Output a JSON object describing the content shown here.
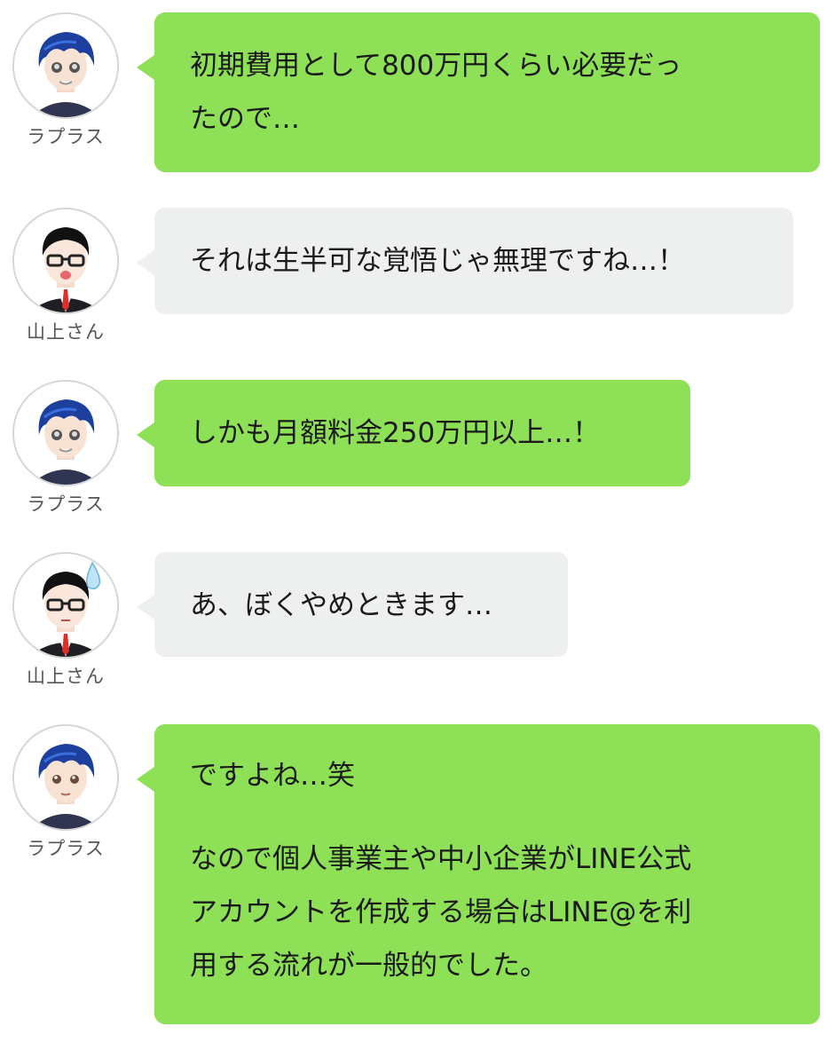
{
  "colors": {
    "laplace_bubble": "#8ee056",
    "yamagami_bubble": "#eef0ef",
    "avatar_border": "#d6d6d6"
  },
  "speakers": {
    "laplace": "ラプラス",
    "yamagami": "山上さん"
  },
  "messages": [
    {
      "speaker": "ラプラス",
      "avatar": "blue-hair-boy-avatar",
      "lines": [
        "初期費用として800万円くらい必要だっ",
        "たので…"
      ]
    },
    {
      "speaker": "山上さん",
      "avatar": "glasses-man-avatar",
      "lines": [
        "それは生半可な覚悟じゃ無理ですね…！"
      ]
    },
    {
      "speaker": "ラプラス",
      "avatar": "blue-hair-boy-avatar",
      "lines": [
        "しかも月額料金250万円以上…！"
      ]
    },
    {
      "speaker": "山上さん",
      "avatar": "glasses-man-sweat-avatar",
      "lines": [
        "あ、ぼくやめときます…"
      ]
    },
    {
      "speaker": "ラプラス",
      "avatar": "blue-hair-boy-smile-avatar",
      "lines": [
        "ですよね…笑"
      ],
      "lines2": [
        "なので個人事業主や中小企業がLINE公式",
        "アカウントを作成する場合はLINE@を利",
        "用する流れが一般的でした。"
      ]
    }
  ]
}
